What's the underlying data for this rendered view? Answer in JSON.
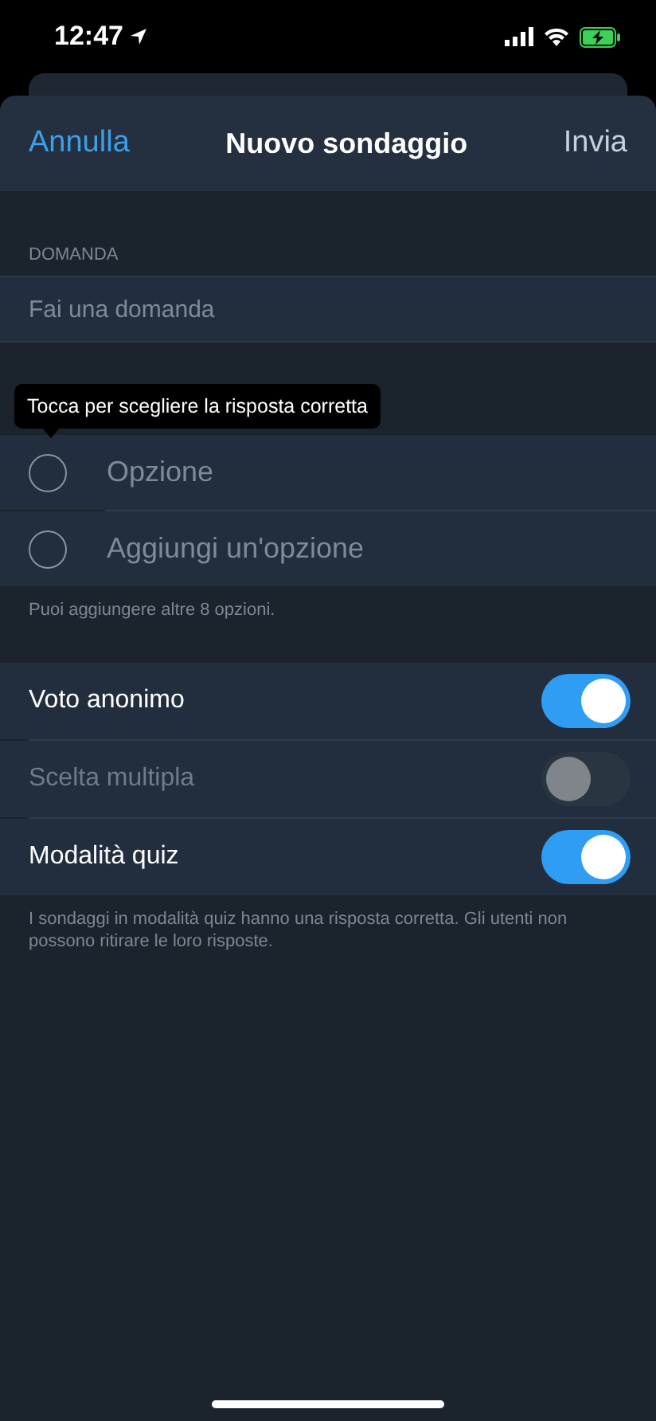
{
  "status_bar": {
    "time": "12:47"
  },
  "header": {
    "cancel": "Annulla",
    "title": "Nuovo sondaggio",
    "send": "Invia"
  },
  "question": {
    "label": "DOMANDA",
    "placeholder": "Fai una domanda"
  },
  "tooltip": "Tocca per scegliere la risposta corretta",
  "options": [
    {
      "placeholder": "Opzione",
      "selected": false
    },
    {
      "placeholder": "Aggiungi un'opzione",
      "selected": false
    }
  ],
  "options_note": "Puoi aggiungere altre 8 opzioni.",
  "settings": [
    {
      "label": "Voto anonimo",
      "on": true,
      "disabled": false
    },
    {
      "label": "Scelta multipla",
      "on": false,
      "disabled": true
    },
    {
      "label": "Modalità quiz",
      "on": true,
      "disabled": false
    }
  ],
  "settings_note": "I sondaggi in modalità quiz hanno una risposta corretta. Gli utenti non possono ritirare le loro risposte."
}
